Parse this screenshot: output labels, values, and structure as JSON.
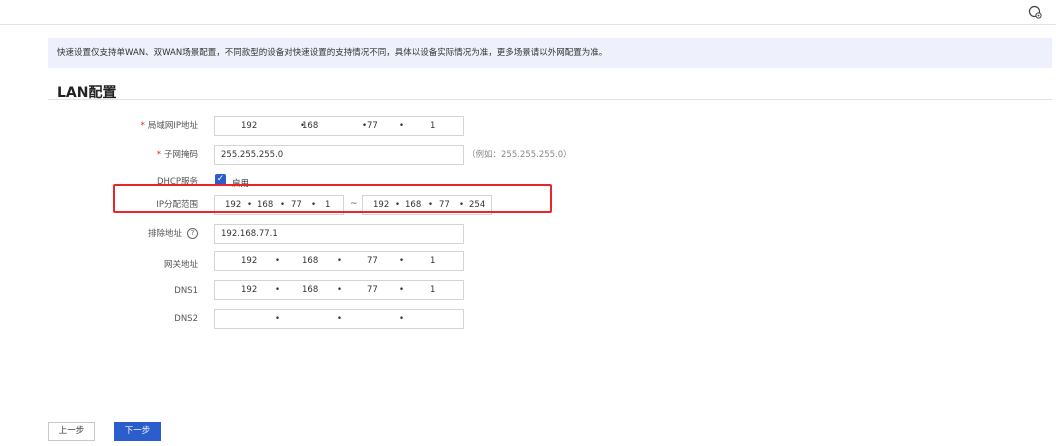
{
  "header": {
    "icon": "settings-gear-icon"
  },
  "notice": "快速设置仅支持单WAN、双WAN场景配置，不同款型的设备对快速设置的支持情况不同，具体以设备实际情况为准，更多场景请以外网配置为准。",
  "section_title": "LAN配置",
  "form": {
    "lan_ip": {
      "label": "局域网IP地址",
      "octets": [
        "192",
        "168",
        "77",
        "1"
      ]
    },
    "subnet_mask": {
      "label": "子网掩码",
      "value": "255.255.255.0",
      "hint": "（例如：255.255.255.0）"
    },
    "dhcp": {
      "label": "DHCP服务",
      "checkbox_label": "启用",
      "checked": true
    },
    "ip_range": {
      "label": "IP分配范围",
      "start": [
        "192",
        "168",
        "77",
        "1"
      ],
      "separator": "~",
      "end": [
        "192",
        "168",
        "77",
        "254"
      ]
    },
    "exclude": {
      "label": "排除地址",
      "value": "192.168.77.1",
      "help_icon": "question-circle-icon"
    },
    "gateway": {
      "label": "网关地址",
      "octets": [
        "192",
        "168",
        "77",
        "1"
      ]
    },
    "dns1": {
      "label": "DNS1",
      "octets": [
        "192",
        "168",
        "77",
        "1"
      ]
    },
    "dns2": {
      "label": "DNS2",
      "octets": [
        "",
        "",
        "",
        ""
      ]
    }
  },
  "buttons": {
    "prev": "上一步",
    "next": "下一步"
  },
  "colors": {
    "accent": "#2b5dcd",
    "highlight": "#e8262a",
    "notice_bg": "#eef0fb"
  }
}
